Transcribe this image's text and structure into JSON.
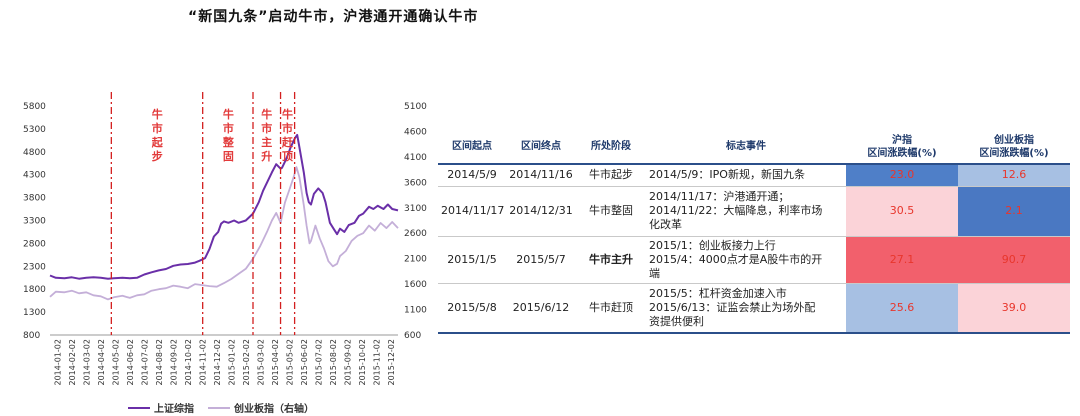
{
  "title": "“新国九条”启动牛市，沪港通开通确认牛市",
  "chart_data": {
    "type": "line",
    "x_tick_labels": [
      "2014-01-02",
      "2014-02-02",
      "2014-03-02",
      "2014-04-02",
      "2014-05-02",
      "2014-06-02",
      "2014-07-02",
      "2014-08-02",
      "2014-09-02",
      "2014-10-02",
      "2014-11-02",
      "2014-12-02",
      "2015-01-02",
      "2015-02-02",
      "2015-03-02",
      "2015-04-02",
      "2015-05-02",
      "2015-06-02",
      "2015-07-02",
      "2015-08-02",
      "2015-09-02",
      "2015-10-02",
      "2015-11-02",
      "2015-12-02"
    ],
    "left_axis": {
      "min": 800,
      "max": 5800,
      "ticks": [
        "5800",
        "5300",
        "4800",
        "4300",
        "3800",
        "3300",
        "2800",
        "2300",
        "1800",
        "1300",
        "800"
      ]
    },
    "right_axis": {
      "min": 600,
      "max": 5100,
      "ticks": [
        "5100",
        "4600",
        "4100",
        "3600",
        "3100",
        "2600",
        "2100",
        "1600",
        "1100",
        "600"
      ]
    },
    "series": [
      {
        "name": "上证综指",
        "axis": "left",
        "color": "#6a2fa8",
        "points": [
          [
            0,
            2100
          ],
          [
            0.4,
            2050
          ],
          [
            1,
            2040
          ],
          [
            1.5,
            2060
          ],
          [
            2,
            2030
          ],
          [
            2.5,
            2050
          ],
          [
            3,
            2060
          ],
          [
            3.5,
            2050
          ],
          [
            4,
            2030
          ],
          [
            4.4,
            2040
          ],
          [
            5,
            2050
          ],
          [
            5.5,
            2040
          ],
          [
            6,
            2050
          ],
          [
            6.5,
            2120
          ],
          [
            7,
            2170
          ],
          [
            7.5,
            2210
          ],
          [
            8,
            2240
          ],
          [
            8.5,
            2310
          ],
          [
            9,
            2340
          ],
          [
            9.5,
            2350
          ],
          [
            10,
            2380
          ],
          [
            10.3,
            2420
          ],
          [
            10.7,
            2480
          ],
          [
            11,
            2680
          ],
          [
            11.3,
            2950
          ],
          [
            11.6,
            3050
          ],
          [
            11.8,
            3230
          ],
          [
            12,
            3280
          ],
          [
            12.3,
            3250
          ],
          [
            12.7,
            3300
          ],
          [
            13,
            3250
          ],
          [
            13.5,
            3300
          ],
          [
            14,
            3450
          ],
          [
            14.4,
            3700
          ],
          [
            14.7,
            3950
          ],
          [
            15,
            4150
          ],
          [
            15.3,
            4350
          ],
          [
            15.6,
            4530
          ],
          [
            15.9,
            4430
          ],
          [
            16,
            4450
          ],
          [
            16.3,
            4650
          ],
          [
            16.6,
            4900
          ],
          [
            16.9,
            5100
          ],
          [
            17.05,
            5170
          ],
          [
            17.2,
            4900
          ],
          [
            17.5,
            4350
          ],
          [
            17.7,
            3900
          ],
          [
            17.85,
            3700
          ],
          [
            18,
            3650
          ],
          [
            18.2,
            3880
          ],
          [
            18.5,
            4000
          ],
          [
            18.8,
            3900
          ],
          [
            19,
            3700
          ],
          [
            19.3,
            3250
          ],
          [
            19.6,
            3100
          ],
          [
            19.8,
            3000
          ],
          [
            20,
            3120
          ],
          [
            20.3,
            3050
          ],
          [
            20.6,
            3200
          ],
          [
            21,
            3250
          ],
          [
            21.3,
            3400
          ],
          [
            21.6,
            3450
          ],
          [
            22,
            3600
          ],
          [
            22.3,
            3550
          ],
          [
            22.6,
            3620
          ],
          [
            23,
            3550
          ],
          [
            23.3,
            3650
          ],
          [
            23.6,
            3550
          ],
          [
            24,
            3520
          ]
        ]
      },
      {
        "name": "创业板指",
        "axis": "right",
        "color": "#c4afd8",
        "points": [
          [
            0,
            1350
          ],
          [
            0.4,
            1450
          ],
          [
            1,
            1440
          ],
          [
            1.5,
            1470
          ],
          [
            2,
            1420
          ],
          [
            2.5,
            1440
          ],
          [
            3,
            1380
          ],
          [
            3.5,
            1360
          ],
          [
            4,
            1300
          ],
          [
            4.4,
            1340
          ],
          [
            5,
            1370
          ],
          [
            5.5,
            1330
          ],
          [
            6,
            1380
          ],
          [
            6.5,
            1400
          ],
          [
            7,
            1470
          ],
          [
            7.5,
            1500
          ],
          [
            8,
            1520
          ],
          [
            8.5,
            1570
          ],
          [
            9,
            1550
          ],
          [
            9.5,
            1520
          ],
          [
            10,
            1600
          ],
          [
            10.5,
            1580
          ],
          [
            11,
            1560
          ],
          [
            11.5,
            1550
          ],
          [
            12,
            1620
          ],
          [
            12.5,
            1700
          ],
          [
            13,
            1800
          ],
          [
            13.5,
            1900
          ],
          [
            14,
            2100
          ],
          [
            14.5,
            2350
          ],
          [
            15,
            2650
          ],
          [
            15.3,
            2850
          ],
          [
            15.6,
            3000
          ],
          [
            15.9,
            2800
          ],
          [
            16.2,
            3200
          ],
          [
            16.5,
            3450
          ],
          [
            16.8,
            3700
          ],
          [
            17,
            3900
          ],
          [
            17.2,
            3700
          ],
          [
            17.5,
            3150
          ],
          [
            17.7,
            2750
          ],
          [
            17.9,
            2400
          ],
          [
            18,
            2450
          ],
          [
            18.3,
            2750
          ],
          [
            18.6,
            2500
          ],
          [
            18.9,
            2300
          ],
          [
            19.2,
            2050
          ],
          [
            19.5,
            1950
          ],
          [
            19.8,
            2000
          ],
          [
            20,
            2150
          ],
          [
            20.4,
            2250
          ],
          [
            20.8,
            2450
          ],
          [
            21.2,
            2550
          ],
          [
            21.6,
            2600
          ],
          [
            22,
            2750
          ],
          [
            22.4,
            2650
          ],
          [
            22.8,
            2800
          ],
          [
            23.2,
            2700
          ],
          [
            23.6,
            2820
          ],
          [
            24,
            2700
          ]
        ]
      }
    ],
    "phase_lines_x": [
      4.23,
      10.53,
      14.0,
      15.9,
      16.87
    ],
    "phase_labels": [
      {
        "text": "牛市起步",
        "x": 7.4
      },
      {
        "text": "牛市整固",
        "x": 12.3
      },
      {
        "text": "牛市主升",
        "x": 14.95
      },
      {
        "text": "牛市赶顶",
        "x": 16.38
      }
    ]
  },
  "legend": {
    "sh": "上证综指",
    "gem": "创业板指（右轴）"
  },
  "table": {
    "headers": {
      "start": "区间起点",
      "end": "区间终点",
      "stage": "所处阶段",
      "event": "标志事件",
      "sh": [
        "沪指",
        "区间涨跌幅(%)"
      ],
      "gem": [
        "创业板指",
        "区间涨跌幅(%)"
      ]
    },
    "rows": [
      {
        "start": "2014/5/9",
        "end": "2014/11/16",
        "stage": "牛市起步",
        "event": [
          "2014/5/9：IPO新规，新国九条"
        ],
        "sh": "23.0",
        "gem": "12.6",
        "sh_bg": "#4f7fc8",
        "gem_bg": "#a7c0e3",
        "bold": false
      },
      {
        "start": "2014/11/17",
        "end": "2014/12/31",
        "stage": "牛市整固",
        "event": [
          "2014/11/17：沪港通开通；",
          "2014/11/22：大幅降息，利率市场",
          "化改革"
        ],
        "sh": "30.5",
        "gem": "2.1",
        "sh_bg": "#fbd3d8",
        "gem_bg": "#4a78c2",
        "bold": false
      },
      {
        "start": "2015/1/5",
        "end": "2015/5/7",
        "stage": "牛市主升",
        "event": [
          "2015/1：创业板接力上行",
          "2015/4：4000点才是A股牛市的开",
          "端"
        ],
        "sh": "27.1",
        "gem": "90.7",
        "sh_bg": "#f2606c",
        "gem_bg": "#f2606c",
        "bold": true
      },
      {
        "start": "2015/5/8",
        "end": "2015/6/12",
        "stage": "牛市赶顶",
        "event": [
          "2015/5：杠杆资金加速入市",
          "2015/6/13：证监会禁止为场外配",
          "资提供便利"
        ],
        "sh": "25.6",
        "gem": "39.0",
        "sh_bg": "#a7c0e3",
        "gem_bg": "#fbd3d8",
        "bold": false
      }
    ]
  }
}
